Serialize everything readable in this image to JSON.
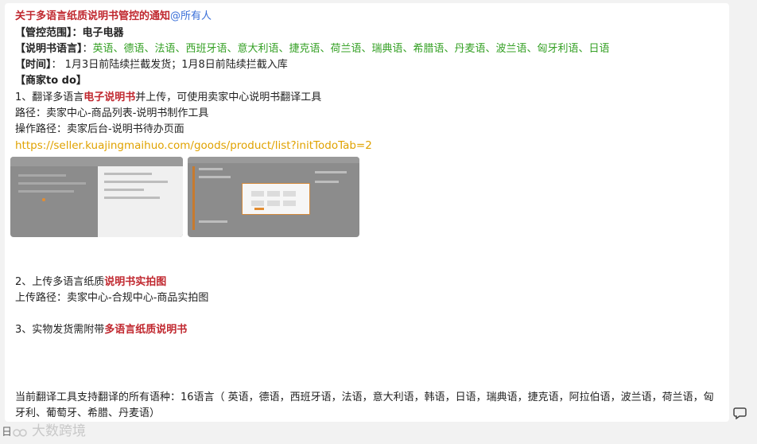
{
  "message": {
    "title": "关于多语言纸质说明书管控的通知",
    "mention": "@所有人",
    "scope_label": "【管控范围】：",
    "scope_value": "电子电器",
    "lang_label": "【说明书语言】",
    "lang_sep": "：",
    "lang_value": "英语、德语、法语、西班牙语、意大利语、捷克语、荷兰语、瑞典语、希腊语、丹麦语、波兰语、匈牙利语、日语",
    "time_label": "【时间】",
    "time_value": "：  1月3日前陆续拦截发货；1月8日前陆续拦截入库",
    "todo_label": "【商家to do】",
    "step1_prefix": "1、翻译多语言",
    "step1_highlight": "电子说明书",
    "step1_suffix": "并上传，可使用卖家中心说明书翻译工具",
    "path1": "路径：卖家中心-商品列表-说明书制作工具",
    "path2": "操作路径：卖家后台-说明书待办页面",
    "link": "https://seller.kuajingmaihuo.com/goods/product/list?initTodoTab=2",
    "step2_prefix": "2、上传多语言纸质",
    "step2_highlight": "说明书实拍图",
    "path3": "上传路径：卖家中心-合规中心-商品实拍图",
    "step3_prefix": "3、实物发货需附带",
    "step3_highlight": "多语言纸质说明书",
    "languages_note": "当前翻译工具支持翻译的所有语种：16语言（ 英语，德语，西班牙语，法语，意大利语，韩语，日语，瑞典语，捷克语，阿拉伯语，波兰语，荷兰语，匈牙利、葡萄牙、希腊、丹麦语）"
  },
  "watermark": "大数跨境",
  "footer_prefix": "日",
  "icons": {
    "reply": "reply-icon",
    "screenshot1": "screenshot-thumbnail",
    "screenshot2": "screenshot-thumbnail"
  }
}
